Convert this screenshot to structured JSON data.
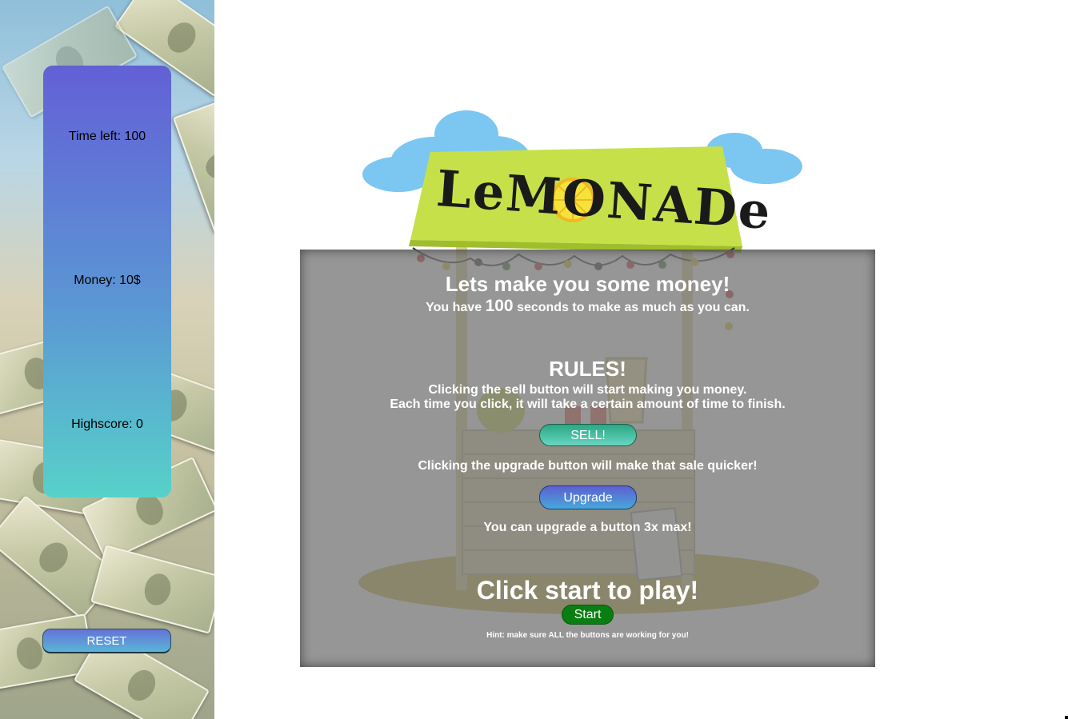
{
  "sidebar": {
    "time_label": "Time left:",
    "time_value": "100",
    "money_label": "Money:",
    "money_value": "10$",
    "highscore_label": "Highscore:",
    "highscore_value": "0",
    "reset_label": "RESET"
  },
  "stand": {
    "sign_text": "LeMONADe"
  },
  "modal": {
    "title": "Lets make you some money!",
    "intro_prefix": "You have",
    "intro_seconds": "100",
    "intro_suffix": "seconds to make as much as you can.",
    "rules_heading": "RULES!",
    "rule_sell_1": "Clicking the sell button will start making you money.",
    "rule_sell_2": "Each time you click, it will take a certain amount of time to finish.",
    "sell_label": "SELL!",
    "rule_upgrade": "Clicking the upgrade button will make that sale quicker!",
    "upgrade_label": "Upgrade",
    "rule_max": "You can upgrade a button 3x max!",
    "cta": "Click start to play!",
    "start_label": "Start",
    "hint": "Hint: make sure ALL the buttons are working for you!"
  },
  "colors": {
    "panel_top": "#6360d6",
    "panel_bottom": "#57d1c9",
    "start_green": "#0a7e12",
    "sell_teal": "#2aa782",
    "upgrade_blue": "#5d60d2"
  }
}
